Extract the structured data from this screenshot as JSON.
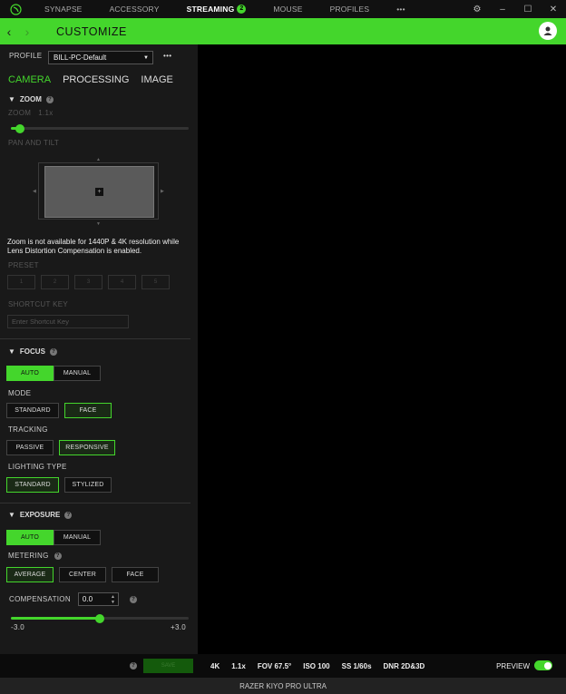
{
  "nav": {
    "items": [
      "SYNAPSE",
      "ACCESSORY",
      "STREAMING",
      "MOUSE",
      "PROFILES"
    ],
    "active": "STREAMING",
    "streaming_badge": "2",
    "more": "•••"
  },
  "header": {
    "title": "CUSTOMIZE"
  },
  "profile": {
    "label": "PROFILE",
    "value": "BILL-PC-Default",
    "more": "•••"
  },
  "tabs": [
    "CAMERA",
    "PROCESSING",
    "IMAGE"
  ],
  "zoom": {
    "section": "ZOOM",
    "label": "ZOOM",
    "value": "1.1x",
    "level": 0.05,
    "pan_tilt_label": "PAN AND TILT",
    "note": "Zoom is not available for 1440P & 4K resolution while Lens Distortion Compensation is enabled.",
    "preset_label": "PRESET",
    "presets": [
      "1",
      "2",
      "3",
      "4",
      "5"
    ],
    "shortcut_label": "SHORTCUT KEY",
    "shortcut_placeholder": "Enter Shortcut Key"
  },
  "focus": {
    "section": "FOCUS",
    "auto": "AUTO",
    "manual": "MANUAL",
    "mode_label": "MODE",
    "mode_standard": "STANDARD",
    "mode_face": "FACE",
    "tracking_label": "TRACKING",
    "tracking_passive": "PASSIVE",
    "tracking_responsive": "RESPONSIVE",
    "lighting_label": "LIGHTING TYPE",
    "lighting_standard": "STANDARD",
    "lighting_stylized": "STYLIZED"
  },
  "exposure": {
    "section": "EXPOSURE",
    "auto": "AUTO",
    "manual": "MANUAL",
    "metering_label": "METERING",
    "metering_average": "AVERAGE",
    "metering_center": "CENTER",
    "metering_face": "FACE",
    "compensation_label": "COMPENSATION",
    "compensation_value": "0.0",
    "min": "-3.0",
    "max": "+3.0",
    "level": 0.5
  },
  "bottom": {
    "save": "SAVE",
    "stats": [
      "4K",
      "1.1x",
      "FOV 67.5°",
      "ISO 100",
      "SS 1/60s",
      "DNR 2D&3D"
    ],
    "preview": "PREVIEW"
  },
  "footer": {
    "device": "RAZER KIYO PRO ULTRA"
  },
  "colors": {
    "accent": "#44d62c",
    "panel": "#191919",
    "background": "#000000"
  },
  "icons": {
    "logo": "razer-snake-icon",
    "settings": "gear-icon",
    "minimize": "minimize-icon",
    "maximize": "maximize-icon",
    "close": "close-icon",
    "back": "chevron-left-icon",
    "forward": "chevron-right-icon",
    "account": "user-icon",
    "help": "help-icon",
    "dropdown": "caret-down-icon"
  }
}
